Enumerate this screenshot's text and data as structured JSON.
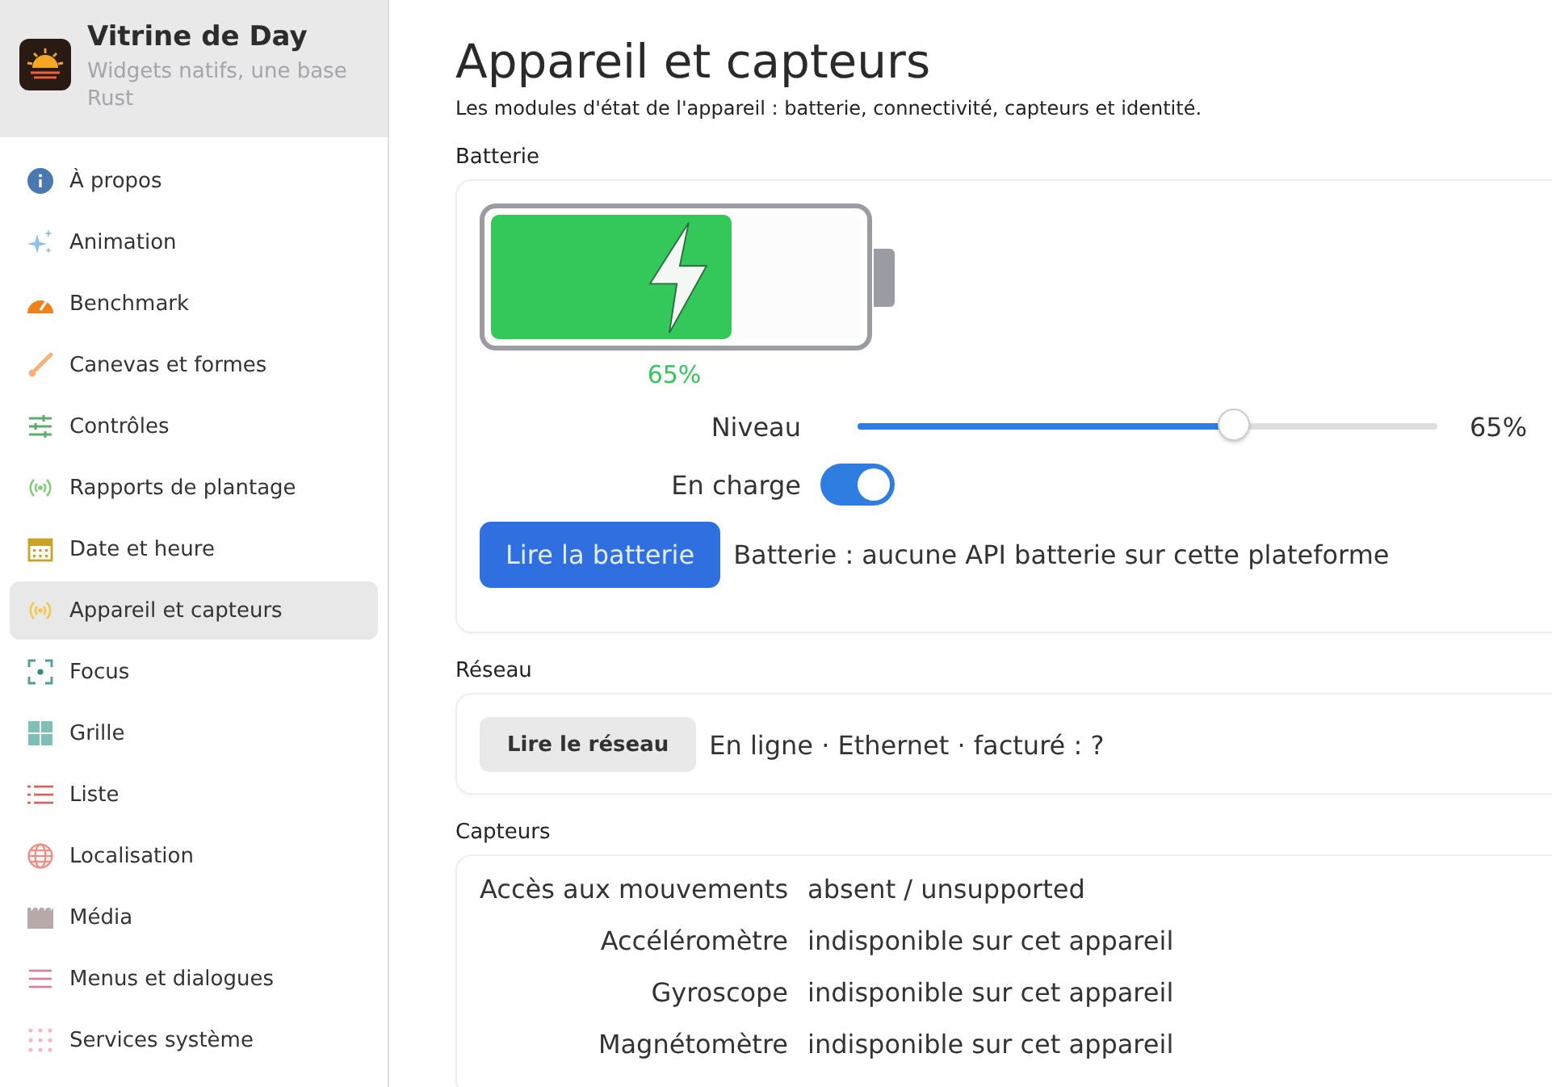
{
  "app": {
    "title": "Vitrine de Day",
    "subtitle": "Widgets natifs, une base Rust"
  },
  "sidebar": {
    "items": [
      {
        "label": "À propos",
        "selected": false
      },
      {
        "label": "Animation",
        "selected": false
      },
      {
        "label": "Benchmark",
        "selected": false
      },
      {
        "label": "Canevas et formes",
        "selected": false
      },
      {
        "label": "Contrôles",
        "selected": false
      },
      {
        "label": "Rapports de plantage",
        "selected": false
      },
      {
        "label": "Date et heure",
        "selected": false
      },
      {
        "label": "Appareil et capteurs",
        "selected": true
      },
      {
        "label": "Focus",
        "selected": false
      },
      {
        "label": "Grille",
        "selected": false
      },
      {
        "label": "Liste",
        "selected": false
      },
      {
        "label": "Localisation",
        "selected": false
      },
      {
        "label": "Média",
        "selected": false
      },
      {
        "label": "Menus et dialogues",
        "selected": false
      },
      {
        "label": "Services système",
        "selected": false
      }
    ]
  },
  "page": {
    "title": "Appareil et capteurs",
    "description": "Les modules d'état de l'appareil : batterie, connectivité, capteurs et identité."
  },
  "battery": {
    "heading": "Batterie",
    "level": 0.65,
    "percent": "65%",
    "charging": true,
    "slider": {
      "label": "Niveau",
      "level": 0.65,
      "reading": "65%"
    },
    "toggle": {
      "label": "En charge",
      "on": true
    },
    "button": "Lire la batterie",
    "status": "Batterie : aucune API batterie sur cette plateforme"
  },
  "network": {
    "heading": "Réseau",
    "button": "Lire le réseau",
    "status": "En ligne · Ethernet · facturé : ?"
  },
  "sensors": {
    "heading": "Capteurs",
    "rows": [
      {
        "label": "Accès aux mouvements",
        "value": "absent / unsupported"
      },
      {
        "label": "Accéléromètre",
        "value": "indisponible sur cet appareil"
      },
      {
        "label": "Gyroscope",
        "value": "indisponible sur cet appareil"
      },
      {
        "label": "Magnétomètre",
        "value": "indisponible sur cet appareil"
      }
    ]
  }
}
